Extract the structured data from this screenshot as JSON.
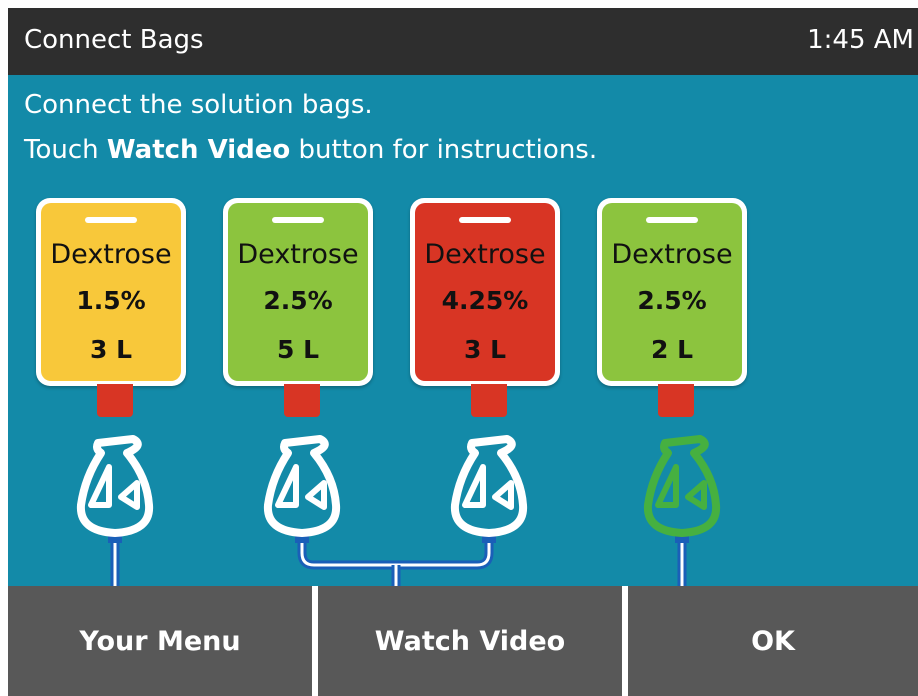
{
  "header": {
    "title": "Connect Bags",
    "time": "1:45 AM"
  },
  "instructions": {
    "line1": "Connect the solution bags.",
    "line2_prefix": "Touch ",
    "line2_bold": "Watch Video",
    "line2_suffix": " button for instructions."
  },
  "bags": [
    {
      "name": "Dextrose",
      "concentration": "1.5%",
      "volume": "3 L",
      "color": "#f8c83a",
      "connector_state": "disconnected"
    },
    {
      "name": "Dextrose",
      "concentration": "2.5%",
      "volume": "5 L",
      "color": "#8cc43e",
      "connector_state": "disconnected"
    },
    {
      "name": "Dextrose",
      "concentration": "4.25%",
      "volume": "3 L",
      "color": "#d83524",
      "connector_state": "disconnected"
    },
    {
      "name": "Dextrose",
      "concentration": "2.5%",
      "volume": "2 L",
      "color": "#8cc43e",
      "connector_state": "connected"
    }
  ],
  "colors": {
    "title_bar": "#2e2e2e",
    "screen_background": "#138aa8",
    "button": "#585858",
    "port": "#d83524",
    "tube": "#1a5fb8",
    "connector_connected": "#46b040",
    "connector_disconnected": "#ffffff"
  },
  "buttons": {
    "menu": "Your Menu",
    "video": "Watch Video",
    "ok": "OK"
  }
}
